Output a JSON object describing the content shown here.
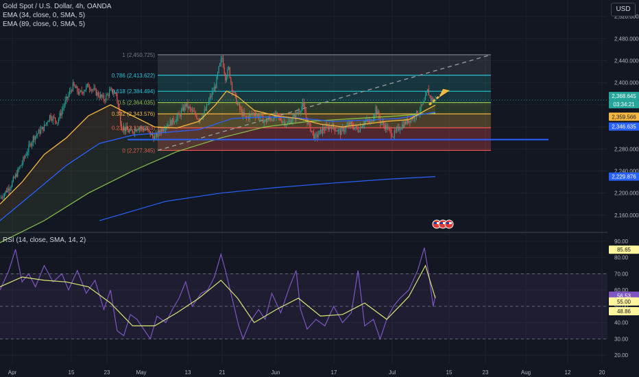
{
  "header": {
    "title": "Gold Spot / U.S. Dollar, 4h, OANDA",
    "ema1": "EMA (34, close, 0, SMA, 5)",
    "ema2": "EMA (89, close, 0, SMA, 5)",
    "currency": "USD"
  },
  "colors": {
    "background": "#131722",
    "grid": "#1e222d",
    "candle_up": "#26a69a",
    "candle_down": "#ef5350",
    "ema34": "#f5b841",
    "ema89": "#2962ff",
    "ema200": "#8bc34a",
    "rsi_line": "#7e57c2",
    "rsi_ma": "#dce775",
    "projection_arrow": "#f5b841",
    "support_line": "#2962ff"
  },
  "price_axis": {
    "ticks": [
      "2,520.000",
      "2,480.000",
      "2,440.000",
      "2,400.000",
      "2,360.000",
      "2,320.000",
      "2,280.000",
      "2,240.000",
      "2,200.000",
      "2,160.000"
    ],
    "tick_values": [
      2520,
      2480,
      2440,
      2400,
      2360,
      2320,
      2280,
      2240,
      2200,
      2160
    ],
    "current_price": "2,368.645",
    "countdown": "03:34:21",
    "ema34_label": "2,359.566",
    "ema89_label": "2,346.635",
    "ema200_label": "2,229.876"
  },
  "rsi_axis": {
    "ticks": [
      "90.00",
      "80.00",
      "70.00",
      "60.00",
      "50.00",
      "40.00",
      "30.00",
      "20.00"
    ],
    "tick_values": [
      90,
      80,
      70,
      60,
      50,
      40,
      30,
      20
    ],
    "rsi_value": "56.53",
    "upper_value": "85.65",
    "rsi_ma_value": "55.00",
    "lower_value": "48.86"
  },
  "time_axis": {
    "labels": [
      "Apr",
      "15",
      "23",
      "May",
      "13",
      "21",
      "Jun",
      "17",
      "Jul",
      "15",
      "23",
      "Aug",
      "12",
      "20"
    ]
  },
  "rsi_panel": {
    "legend": "RSI (14, close, SMA, 14, 2)"
  },
  "fibonacci": {
    "levels": [
      {
        "ratio": "1",
        "price": 2450.725,
        "label": "1 (2,450.725)"
      },
      {
        "ratio": "0.786",
        "price": 2413.622,
        "label": "0.786 (2,413.622)"
      },
      {
        "ratio": "0.618",
        "price": 2384.494,
        "label": "0.618 (2,384.494)"
      },
      {
        "ratio": "0.5",
        "price": 2364.035,
        "label": "0.5 (2,364.035)"
      },
      {
        "ratio": "0.382",
        "price": 2343.576,
        "label": "0.382 (2,343.576)"
      },
      {
        "ratio": "0.236",
        "price": 2318.263,
        "label": "0.236 (2,318.263)"
      },
      {
        "ratio": "0",
        "price": 2277.345,
        "label": "0 (2,277.345)"
      }
    ]
  },
  "chart_data": {
    "type": "candlestick",
    "symbol": "Gold Spot / U.S. Dollar",
    "timeframe": "4h",
    "x_range": [
      "Apr",
      "Aug 20"
    ],
    "ylim": [
      2130,
      2550
    ],
    "price_path": [
      [
        0,
        2190
      ],
      [
        10,
        2215
      ],
      [
        20,
        2255
      ],
      [
        30,
        2300
      ],
      [
        40,
        2320
      ],
      [
        45,
        2340
      ],
      [
        52,
        2330
      ],
      [
        58,
        2360
      ],
      [
        66,
        2395
      ],
      [
        72,
        2380
      ],
      [
        80,
        2395
      ],
      [
        88,
        2380
      ],
      [
        94,
        2370
      ],
      [
        100,
        2385
      ],
      [
        105,
        2380
      ],
      [
        110,
        2320
      ],
      [
        118,
        2310
      ],
      [
        125,
        2320
      ],
      [
        132,
        2315
      ],
      [
        140,
        2300
      ],
      [
        148,
        2320
      ],
      [
        156,
        2330
      ],
      [
        162,
        2340
      ],
      [
        168,
        2360
      ],
      [
        175,
        2345
      ],
      [
        180,
        2335
      ],
      [
        183,
        2342
      ],
      [
        186,
        2350
      ],
      [
        190,
        2372
      ],
      [
        195,
        2395
      ],
      [
        198,
        2425
      ],
      [
        201,
        2445
      ],
      [
        204,
        2410
      ],
      [
        207,
        2425
      ],
      [
        210,
        2390
      ],
      [
        216,
        2355
      ],
      [
        222,
        2335
      ],
      [
        230,
        2345
      ],
      [
        240,
        2330
      ],
      [
        250,
        2340
      ],
      [
        260,
        2325
      ],
      [
        268,
        2342
      ],
      [
        274,
        2360
      ],
      [
        278,
        2330
      ],
      [
        285,
        2300
      ],
      [
        292,
        2315
      ],
      [
        300,
        2322
      ],
      [
        308,
        2310
      ],
      [
        316,
        2325
      ],
      [
        324,
        2315
      ],
      [
        330,
        2330
      ],
      [
        336,
        2328
      ],
      [
        340,
        2355
      ],
      [
        344,
        2330
      ],
      [
        350,
        2318
      ],
      [
        356,
        2305
      ],
      [
        362,
        2320
      ],
      [
        368,
        2330
      ],
      [
        372,
        2335
      ],
      [
        378,
        2345
      ],
      [
        384,
        2365
      ],
      [
        387,
        2385
      ],
      [
        390,
        2370
      ],
      [
        394,
        2368.645
      ]
    ],
    "ema34_path": [
      [
        0,
        2180
      ],
      [
        20,
        2220
      ],
      [
        40,
        2270
      ],
      [
        60,
        2300
      ],
      [
        80,
        2340
      ],
      [
        100,
        2360
      ],
      [
        120,
        2340
      ],
      [
        140,
        2320
      ],
      [
        160,
        2318
      ],
      [
        180,
        2330
      ],
      [
        195,
        2360
      ],
      [
        205,
        2385
      ],
      [
        215,
        2375
      ],
      [
        230,
        2350
      ],
      [
        250,
        2340
      ],
      [
        270,
        2335
      ],
      [
        290,
        2325
      ],
      [
        310,
        2320
      ],
      [
        330,
        2325
      ],
      [
        350,
        2330
      ],
      [
        370,
        2333
      ],
      [
        385,
        2350
      ],
      [
        394,
        2359.566
      ]
    ],
    "ema89_path": [
      [
        0,
        2150
      ],
      [
        30,
        2200
      ],
      [
        60,
        2250
      ],
      [
        90,
        2290
      ],
      [
        120,
        2305
      ],
      [
        150,
        2310
      ],
      [
        180,
        2315
      ],
      [
        210,
        2335
      ],
      [
        240,
        2338
      ],
      [
        270,
        2336
      ],
      [
        300,
        2330
      ],
      [
        330,
        2332
      ],
      [
        360,
        2335
      ],
      [
        394,
        2346.635
      ]
    ],
    "ema200_path": [
      [
        0,
        2110
      ],
      [
        40,
        2150
      ],
      [
        80,
        2200
      ],
      [
        120,
        2240
      ],
      [
        160,
        2275
      ],
      [
        200,
        2300
      ],
      [
        240,
        2320
      ],
      [
        280,
        2330
      ],
      [
        320,
        2335
      ],
      [
        360,
        2340
      ],
      [
        394,
        2345
      ]
    ],
    "ema_long_path": [
      [
        90,
        2150
      ],
      [
        150,
        2185
      ],
      [
        200,
        2200
      ],
      [
        250,
        2210
      ],
      [
        300,
        2218
      ],
      [
        350,
        2225
      ],
      [
        394,
        2229.876
      ]
    ],
    "rsi_ylim": [
      15,
      95
    ],
    "rsi_levels": [
      70,
      50,
      30
    ],
    "rsi_path": [
      [
        0,
        60
      ],
      [
        8,
        72
      ],
      [
        14,
        85
      ],
      [
        20,
        65
      ],
      [
        26,
        70
      ],
      [
        32,
        62
      ],
      [
        40,
        75
      ],
      [
        48,
        65
      ],
      [
        56,
        70
      ],
      [
        62,
        60
      ],
      [
        70,
        72
      ],
      [
        78,
        58
      ],
      [
        86,
        66
      ],
      [
        94,
        48
      ],
      [
        100,
        60
      ],
      [
        106,
        35
      ],
      [
        112,
        32
      ],
      [
        118,
        45
      ],
      [
        124,
        42
      ],
      [
        130,
        36
      ],
      [
        136,
        30
      ],
      [
        142,
        44
      ],
      [
        150,
        40
      ],
      [
        156,
        48
      ],
      [
        162,
        55
      ],
      [
        168,
        65
      ],
      [
        174,
        50
      ],
      [
        182,
        58
      ],
      [
        188,
        60
      ],
      [
        194,
        68
      ],
      [
        200,
        82
      ],
      [
        204,
        72
      ],
      [
        210,
        55
      ],
      [
        216,
        38
      ],
      [
        220,
        30
      ],
      [
        226,
        40
      ],
      [
        234,
        48
      ],
      [
        240,
        42
      ],
      [
        246,
        58
      ],
      [
        254,
        46
      ],
      [
        262,
        62
      ],
      [
        268,
        72
      ],
      [
        272,
        48
      ],
      [
        278,
        36
      ],
      [
        286,
        42
      ],
      [
        294,
        38
      ],
      [
        302,
        50
      ],
      [
        310,
        40
      ],
      [
        318,
        46
      ],
      [
        324,
        72
      ],
      [
        330,
        38
      ],
      [
        338,
        42
      ],
      [
        344,
        30
      ],
      [
        350,
        42
      ],
      [
        356,
        50
      ],
      [
        362,
        55
      ],
      [
        370,
        60
      ],
      [
        378,
        72
      ],
      [
        384,
        86
      ],
      [
        388,
        70
      ],
      [
        392,
        50
      ],
      [
        394,
        56.53
      ]
    ],
    "rsi_ma_path": [
      [
        0,
        62
      ],
      [
        20,
        68
      ],
      [
        40,
        66
      ],
      [
        60,
        65
      ],
      [
        80,
        62
      ],
      [
        100,
        52
      ],
      [
        120,
        38
      ],
      [
        140,
        38
      ],
      [
        160,
        46
      ],
      [
        180,
        55
      ],
      [
        200,
        66
      ],
      [
        215,
        55
      ],
      [
        230,
        40
      ],
      [
        250,
        48
      ],
      [
        270,
        55
      ],
      [
        290,
        44
      ],
      [
        310,
        45
      ],
      [
        330,
        52
      ],
      [
        350,
        42
      ],
      [
        370,
        56
      ],
      [
        385,
        75
      ],
      [
        394,
        55
      ]
    ]
  }
}
